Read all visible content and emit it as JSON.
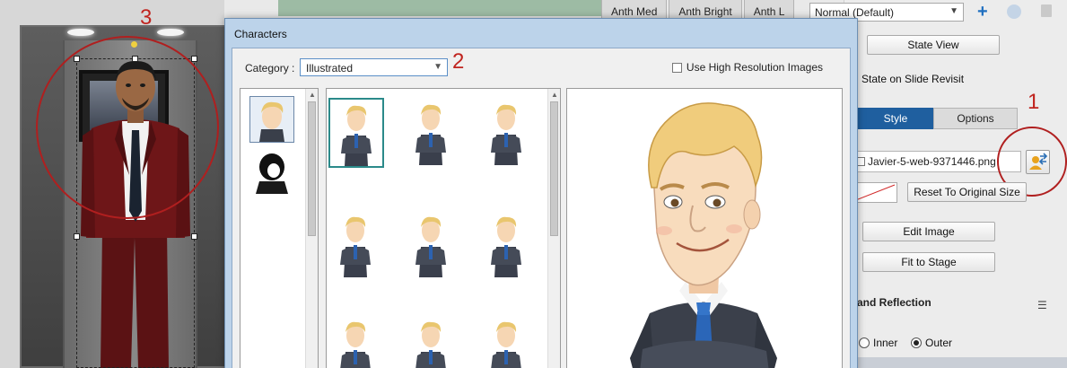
{
  "callouts": {
    "one": "1",
    "two": "2",
    "three": "3"
  },
  "background": {
    "top_tabs": [
      "Anth Med",
      "Anth Bright",
      "Anth L"
    ],
    "state_select": "Normal (Default)",
    "state_view_button": "State View",
    "state_revisit_text": "State on Slide Revisit",
    "tabs": {
      "style": "Style",
      "options": "Options"
    },
    "image_file": "Javier-5-web-9371446.png",
    "reset_button": "Reset To Original Size",
    "edit_image_button": "Edit Image",
    "fit_stage_button": "Fit to Stage",
    "section_title": "and Reflection",
    "radio_inner": "Inner",
    "radio_outer": "Outer"
  },
  "dialog": {
    "title": "Characters",
    "category_label": "Category :",
    "category_value": "Illustrated",
    "high_res_label": "Use High Resolution Images"
  },
  "colors": {
    "accent": "#1f5f9f",
    "callout": "#c0241f",
    "dialog_border": "#6d8fb3"
  }
}
